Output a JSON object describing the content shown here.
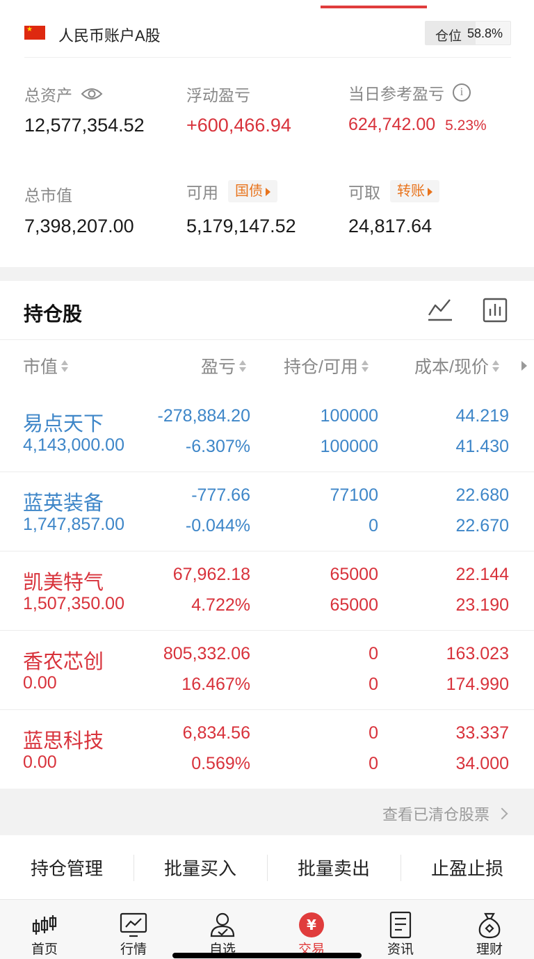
{
  "account": {
    "name": "人民币账户A股",
    "position_label": "仓位",
    "position_value": "58.8%",
    "position_fraction": 0.588
  },
  "summary": {
    "total_assets_label": "总资产",
    "total_assets_value": "12,577,354.52",
    "floating_pl_label": "浮动盈亏",
    "floating_pl_value": "+600,466.94",
    "daily_pl_label": "当日参考盈亏",
    "daily_pl_value": "624,742.00",
    "daily_pl_pct": "5.23%",
    "market_value_label": "总市值",
    "market_value_value": "7,398,207.00",
    "available_label": "可用",
    "available_tag": "国债",
    "available_value": "5,179,147.52",
    "withdrawable_label": "可取",
    "withdrawable_tag": "转账",
    "withdrawable_value": "24,817.64"
  },
  "holdings": {
    "title": "持仓股",
    "columns": [
      "市值",
      "盈亏",
      "持仓/可用",
      "成本/现价"
    ],
    "rows": [
      {
        "name": "易点天下",
        "market_value": "4,143,000.00",
        "pl": "-278,884.20",
        "pl_pct": "-6.307%",
        "position": "100000",
        "available": "100000",
        "cost": "44.219",
        "price": "41.430",
        "trend": "down"
      },
      {
        "name": "蓝英装备",
        "market_value": "1,747,857.00",
        "pl": "-777.66",
        "pl_pct": "-0.044%",
        "position": "77100",
        "available": "0",
        "cost": "22.680",
        "price": "22.670",
        "trend": "down"
      },
      {
        "name": "凯美特气",
        "market_value": "1,507,350.00",
        "pl": "67,962.18",
        "pl_pct": "4.722%",
        "position": "65000",
        "available": "65000",
        "cost": "22.144",
        "price": "23.190",
        "trend": "up"
      },
      {
        "name": "香农芯创",
        "market_value": "0.00",
        "pl": "805,332.06",
        "pl_pct": "16.467%",
        "position": "0",
        "available": "0",
        "cost": "163.023",
        "price": "174.990",
        "trend": "up"
      },
      {
        "name": "蓝思科技",
        "market_value": "0.00",
        "pl": "6,834.56",
        "pl_pct": "0.569%",
        "position": "0",
        "available": "0",
        "cost": "33.337",
        "price": "34.000",
        "trend": "up"
      }
    ],
    "cleared_link": "查看已清仓股票"
  },
  "actions": [
    "持仓管理",
    "批量买入",
    "批量卖出",
    "止盈止损"
  ],
  "tabs": [
    {
      "label": "首页",
      "icon": "candlestick-icon"
    },
    {
      "label": "行情",
      "icon": "market-chart-icon"
    },
    {
      "label": "自选",
      "icon": "user-favorite-icon"
    },
    {
      "label": "交易",
      "icon": "yuan-trade-icon",
      "active": true
    },
    {
      "label": "资讯",
      "icon": "news-document-icon"
    },
    {
      "label": "理财",
      "icon": "money-bag-icon"
    }
  ],
  "colors": {
    "up": "#d8323b",
    "down": "#3e86c8",
    "accent": "#e03c3c",
    "tag": "#e8731c"
  }
}
